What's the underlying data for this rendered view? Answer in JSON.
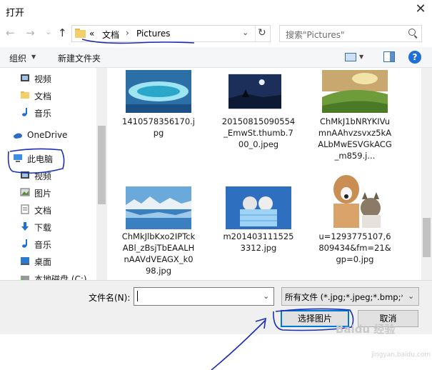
{
  "window": {
    "title": "打开",
    "close_glyph": "✕"
  },
  "nav": {
    "back_glyph": "←",
    "forward_glyph": "→",
    "recent_glyph": "⌄",
    "up_glyph": "↑",
    "address": {
      "prefix": "«",
      "segments": [
        "文档",
        "Pictures"
      ],
      "separator": "›",
      "dropdown_glyph": "⌄",
      "refresh_glyph": "↻"
    },
    "search": {
      "placeholder": "搜索\"Pictures\""
    }
  },
  "toolbar": {
    "organize_label": "组织",
    "new_folder_label": "新建文件夹",
    "caret": "▼",
    "help_glyph": "?"
  },
  "sidebar": {
    "items": [
      {
        "label": "视频",
        "icon": "video-icon"
      },
      {
        "label": "文档",
        "icon": "folder-icon"
      },
      {
        "label": "音乐",
        "icon": "music-icon"
      },
      {
        "label": "OneDrive",
        "icon": "cloud-icon"
      },
      {
        "label": "此电脑",
        "icon": "computer-icon"
      },
      {
        "label": "视频",
        "icon": "video-icon"
      },
      {
        "label": "图片",
        "icon": "pictures-icon"
      },
      {
        "label": "文档",
        "icon": "documents-icon"
      },
      {
        "label": "下载",
        "icon": "download-icon"
      },
      {
        "label": "音乐",
        "icon": "music-icon"
      },
      {
        "label": "桌面",
        "icon": "desktop-icon"
      },
      {
        "label": "本地磁盘 (C:)",
        "icon": "disk-icon"
      }
    ]
  },
  "files": [
    {
      "name": "1410578356170.jpg"
    },
    {
      "name": "20150815090554_EmwSt.thumb.700_0.jpeg"
    },
    {
      "name": "ChMkJ1bNRYKIVumnAAhvzsvxz5kAALbMwESVGkACG_m859.j..."
    },
    {
      "name": "ChMkJlbKxo2IPTckABl_zBsjTbEAALHnAAVdVEAGX_k098.jpg"
    },
    {
      "name": "m2014031115253312.jpg"
    },
    {
      "name": "u=1293775107,6809434&fm=21&gp=0.jpg"
    }
  ],
  "bottom": {
    "filename_label": "文件名(N):",
    "filename_value": "",
    "filetype_value": "所有文件 (*.jpg;*.jpeg;*.bmp;*.",
    "dropdown_glyph": "⌄",
    "open_button": "选择图片",
    "cancel_button": "取消"
  },
  "watermark": {
    "text": "Baidu 经验",
    "sub": "jingyan.baidu.com"
  },
  "colors": {
    "accent": "#0078d7",
    "annotation": "#1a2fb5"
  }
}
